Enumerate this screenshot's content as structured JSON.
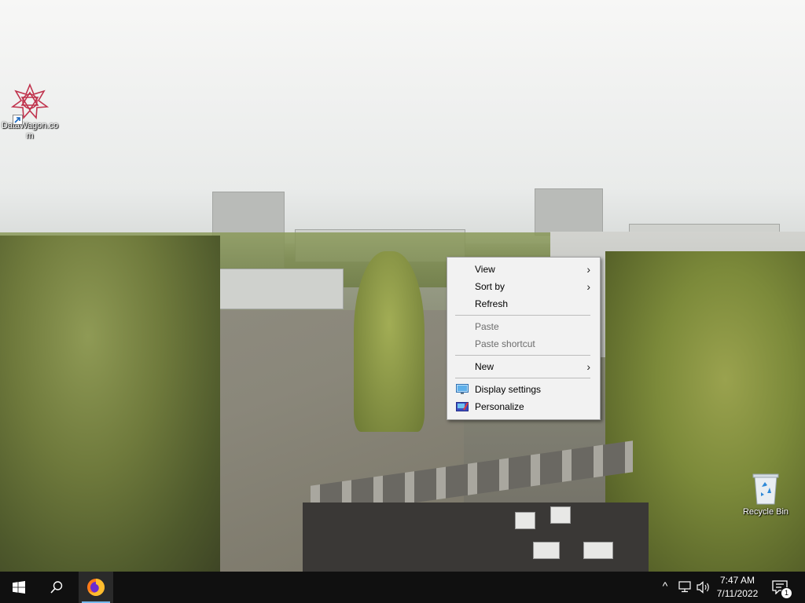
{
  "desktop": {
    "icons": [
      {
        "label": "DataWagon.com",
        "icon": "datawagon-logo-icon"
      },
      {
        "label": "Recycle Bin",
        "icon": "recycle-bin-icon"
      }
    ]
  },
  "context_menu": {
    "items": [
      {
        "label": "View",
        "submenu": true,
        "enabled": true
      },
      {
        "label": "Sort by",
        "submenu": true,
        "enabled": true
      },
      {
        "label": "Refresh",
        "submenu": false,
        "enabled": true
      },
      {
        "label": "Paste",
        "submenu": false,
        "enabled": false
      },
      {
        "label": "Paste shortcut",
        "submenu": false,
        "enabled": false
      },
      {
        "label": "New",
        "submenu": true,
        "enabled": true
      },
      {
        "label": "Display settings",
        "submenu": false,
        "enabled": true,
        "icon": "display-settings-icon"
      },
      {
        "label": "Personalize",
        "submenu": false,
        "enabled": true,
        "icon": "personalize-icon"
      }
    ],
    "submenu_arrow": "›"
  },
  "taskbar": {
    "start_icon": "windows-start-icon",
    "search_icon": "search-icon",
    "pinned": [
      {
        "app": "Firefox",
        "icon": "firefox-icon",
        "active": true
      }
    ],
    "tray": {
      "chevron": "^",
      "time": "7:47 AM",
      "date": "7/11/2022",
      "notification_count": "1"
    }
  },
  "colors": {
    "taskbar_bg": "#101010",
    "menu_bg": "#f2f2f2",
    "active_indicator": "#76b9ed",
    "start_icon": "#ffffff"
  }
}
